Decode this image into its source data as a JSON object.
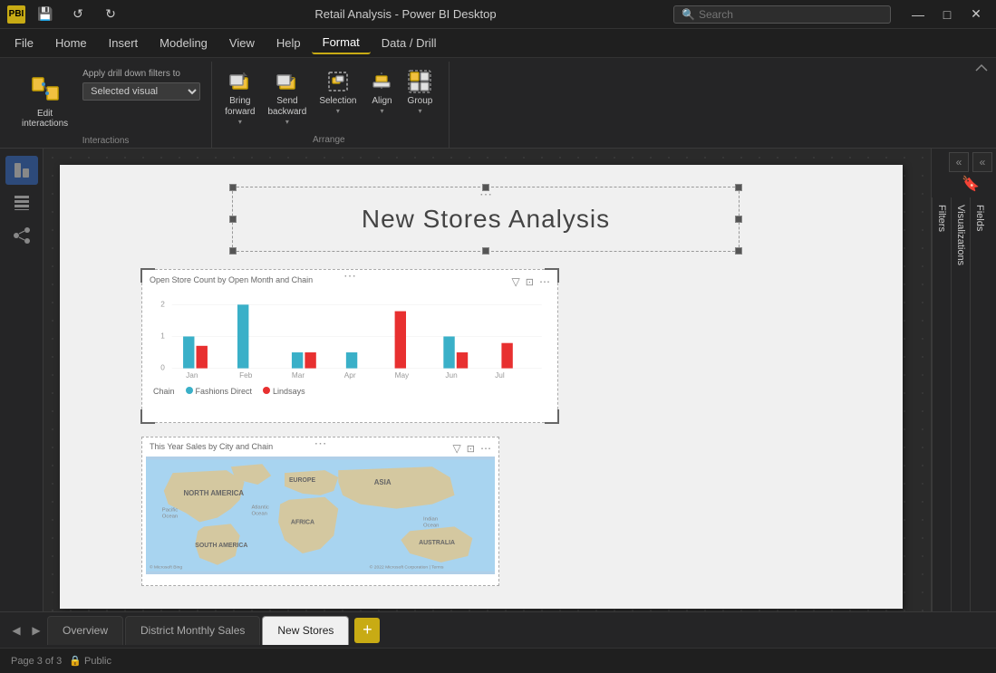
{
  "app": {
    "title": "Retail Analysis - Power BI Desktop",
    "search_placeholder": "Search"
  },
  "titlebar": {
    "save_label": "💾",
    "undo_label": "↺",
    "redo_label": "↻",
    "minimize_label": "—",
    "maximize_label": "□",
    "close_label": "✕"
  },
  "menubar": {
    "items": [
      {
        "label": "File",
        "active": false
      },
      {
        "label": "Home",
        "active": false
      },
      {
        "label": "Insert",
        "active": false
      },
      {
        "label": "Modeling",
        "active": false
      },
      {
        "label": "View",
        "active": false
      },
      {
        "label": "Help",
        "active": false
      },
      {
        "label": "Format",
        "active": true
      },
      {
        "label": "Data / Drill",
        "active": false
      }
    ]
  },
  "ribbon": {
    "interactions_label": "Edit\ninteractions",
    "apply_drill_label": "Apply drill down filters to",
    "apply_drill_option": "Selected visual",
    "bring_forward_label": "Bring\nforward",
    "send_backward_label": "Send\nbackward",
    "selection_label": "Selection",
    "align_label": "Align",
    "group_label": "Group",
    "interactions_section": "Interactions",
    "arrange_section": "Arrange"
  },
  "canvas": {
    "title": "New Stores Analysis",
    "chart1": {
      "title": "Open Store Count by Open Month and Chain",
      "legend_fashions": "Fashions Direct",
      "legend_lindsays": "Lindsays",
      "months": [
        "Jan",
        "Feb",
        "Mar",
        "Apr",
        "May",
        "Jun",
        "Jul"
      ],
      "fashions_values": [
        1,
        2,
        0.5,
        0.5,
        0,
        1,
        0
      ],
      "lindsays_values": [
        0.7,
        0,
        0.5,
        0,
        1.8,
        0.5,
        0.8
      ]
    },
    "chart2": {
      "title": "This Year Sales by City and Chain"
    }
  },
  "right_panel": {
    "filters_label": "Filters",
    "visualizations_label": "Visualizations",
    "fields_label": "Fields"
  },
  "page_tabs": {
    "tabs": [
      {
        "label": "Overview",
        "active": false
      },
      {
        "label": "District Monthly Sales",
        "active": false
      },
      {
        "label": "New Stores",
        "active": true
      }
    ],
    "add_label": "+"
  },
  "statusbar": {
    "page_info": "Page 3 of 3",
    "public_label": "🔒 Public"
  }
}
